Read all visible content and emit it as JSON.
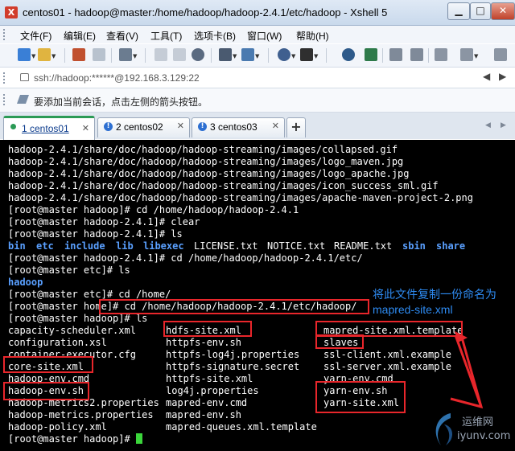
{
  "window": {
    "title": "centos01 - hadoop@master:/home/hadoop/hadoop-2.4.1/etc/hadoop - Xshell 5"
  },
  "menu": [
    "文件(F)",
    "编辑(E)",
    "查看(V)",
    "工具(T)",
    "选项卡(B)",
    "窗口(W)",
    "帮助(H)"
  ],
  "address": {
    "value": "ssh://hadoop:******@192.168.3.129:22"
  },
  "infobar": {
    "message": "要添加当前会话，点击左侧的箭头按钮。"
  },
  "tabs": [
    {
      "label": "1 centos01",
      "active": true
    },
    {
      "label": "2 centos02",
      "active": false
    },
    {
      "label": "3 centos03",
      "active": false
    }
  ],
  "terminal": {
    "lines": [
      "hadoop-2.4.1/share/doc/hadoop/hadoop-streaming/images/collapsed.gif",
      "hadoop-2.4.1/share/doc/hadoop/hadoop-streaming/images/logo_maven.jpg",
      "hadoop-2.4.1/share/doc/hadoop/hadoop-streaming/images/logo_apache.jpg",
      "hadoop-2.4.1/share/doc/hadoop/hadoop-streaming/images/icon_success_sml.gif",
      "hadoop-2.4.1/share/doc/hadoop/hadoop-streaming/images/apache-maven-project-2.png",
      "[root@master hadoop]# cd /home/hadoop/hadoop-2.4.1",
      "[root@master hadoop-2.4.1]# clear",
      "[root@master hadoop-2.4.1]# ls",
      "",
      "[root@master hadoop-2.4.1]# cd /home/hadoop/hadoop-2.4.1/etc/",
      "[root@master etc]# ls",
      "",
      "[root@master etc]# cd /home/",
      "[root@master home]# cd /home/hadoop/hadoop-2.4.1/etc/hadoop/",
      "[root@master hadoop]# ls",
      "capacity-scheduler.xml",
      "configuration.xsl",
      "container-executor.cfg",
      "core-site.xml",
      "hadoop-env.cmd",
      "hadoop-env.sh",
      "hadoop-metrics2.properties",
      "hadoop-metrics.properties",
      "hadoop-policy.xml",
      "[root@master hadoop]# "
    ],
    "ls_root": {
      "dirs": [
        "bin",
        "etc",
        "include",
        "lib",
        "libexec",
        "sbin",
        "share"
      ],
      "files": [
        "LICENSE.txt",
        "NOTICE.txt",
        "README.txt"
      ]
    },
    "ls_etc": {
      "dirs": [
        "hadoop"
      ]
    },
    "col2": [
      "hdfs-site.xml",
      "httpfs-env.sh",
      "httpfs-log4j.properties",
      "httpfs-signature.secret",
      "httpfs-site.xml",
      "log4j.properties",
      "mapred-env.cmd",
      "mapred-env.sh",
      "mapred-queues.xml.template"
    ],
    "col3": [
      "mapred-site.xml.template",
      "slaves",
      "ssl-client.xml.example",
      "ssl-server.xml.example",
      "yarn-env.cmd",
      "yarn-env.sh",
      "yarn-site.xml"
    ]
  },
  "annotation": {
    "line1": "将此文件复制一份命名为",
    "line2": "mapred-site.xml",
    "color": "#2e8bf2"
  },
  "watermark": {
    "line1": "运维网",
    "line2": "iyunv.com"
  },
  "colors": {
    "dir": "#5aa0ff",
    "highlight": "#e8262b",
    "cursor": "#3bd63b",
    "tab_accent": "#2a9a55"
  }
}
